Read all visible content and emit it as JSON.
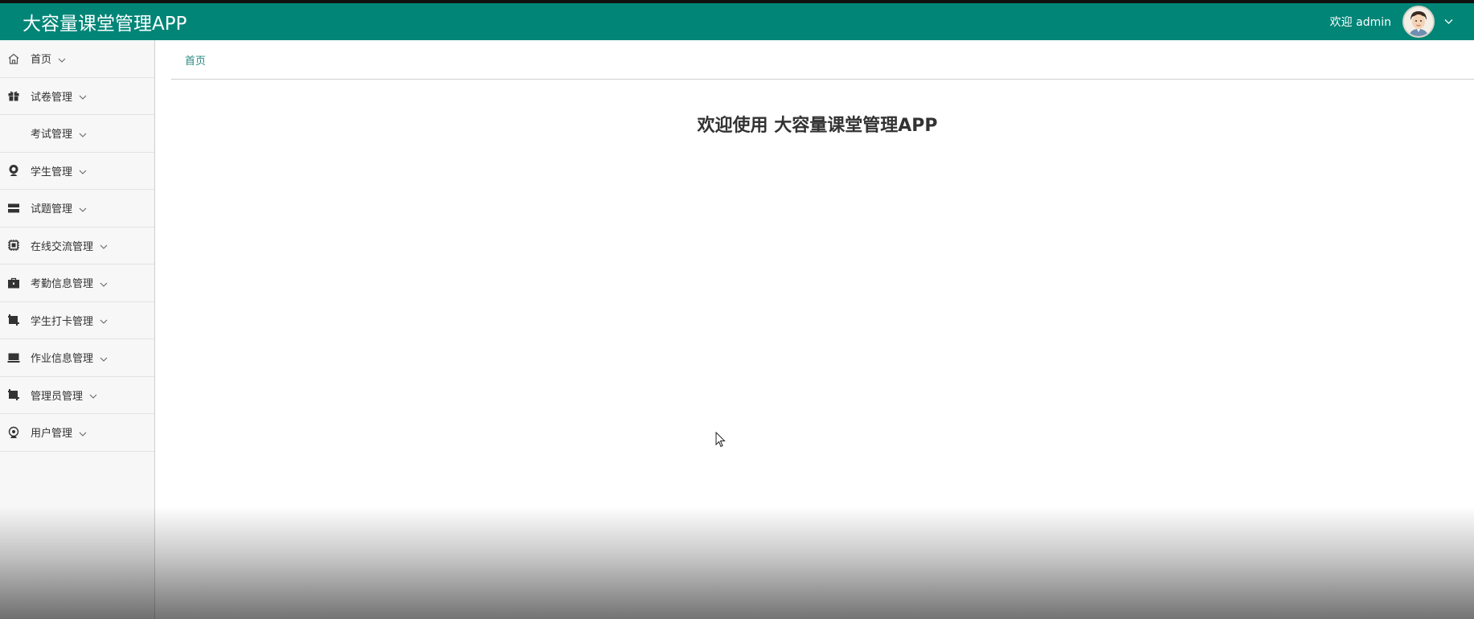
{
  "header": {
    "app_title": "大容量课堂管理APP",
    "welcome_text": "欢迎 admin",
    "avatar_icon": "user-avatar-icon",
    "dropdown_icon": "chevron-down-icon"
  },
  "sidebar": {
    "items": [
      {
        "label": "首页",
        "icon": "home-icon"
      },
      {
        "label": "试卷管理",
        "icon": "gift-icon"
      },
      {
        "label": "考试管理",
        "icon": ""
      },
      {
        "label": "学生管理",
        "icon": "student-icon"
      },
      {
        "label": "试题管理",
        "icon": "server-icon"
      },
      {
        "label": "在线交流管理",
        "icon": "chip-icon"
      },
      {
        "label": "考勤信息管理",
        "icon": "briefcase-icon"
      },
      {
        "label": "学生打卡管理",
        "icon": "crop-icon"
      },
      {
        "label": "作业信息管理",
        "icon": "laptop-icon"
      },
      {
        "label": "管理员管理",
        "icon": "crop-icon"
      },
      {
        "label": "用户管理",
        "icon": "webcam-icon"
      }
    ]
  },
  "main": {
    "breadcrumb": "首页",
    "welcome_title": "欢迎使用 大容量课堂管理APP"
  },
  "colors": {
    "header_bg": "#008577",
    "breadcrumb_text": "#2a8a7f",
    "sidebar_bg": "#f7f7f7"
  }
}
